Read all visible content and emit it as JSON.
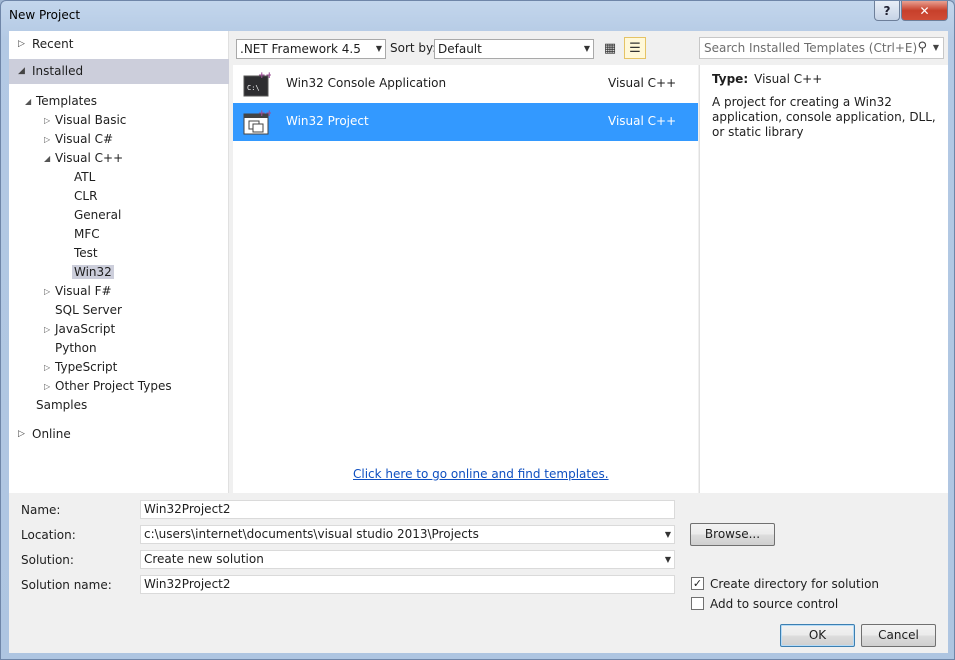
{
  "window": {
    "title": "New Project",
    "help_label": "?",
    "close_label": "✕"
  },
  "left": {
    "recent": "Recent",
    "installed": "Installed",
    "templates": "Templates",
    "tree": [
      {
        "label": "Visual Basic",
        "level": 2,
        "arrow": "▷"
      },
      {
        "label": "Visual C#",
        "level": 2,
        "arrow": "▷"
      },
      {
        "label": "Visual C++",
        "level": 2,
        "arrow": "◢"
      },
      {
        "label": "ATL",
        "level": 3,
        "arrow": ""
      },
      {
        "label": "CLR",
        "level": 3,
        "arrow": ""
      },
      {
        "label": "General",
        "level": 3,
        "arrow": ""
      },
      {
        "label": "MFC",
        "level": 3,
        "arrow": ""
      },
      {
        "label": "Test",
        "level": 3,
        "arrow": ""
      },
      {
        "label": "Win32",
        "level": 3,
        "arrow": "",
        "selected": true
      },
      {
        "label": "Visual F#",
        "level": 2,
        "arrow": "▷"
      },
      {
        "label": "SQL Server",
        "level": 2,
        "arrow": ""
      },
      {
        "label": "JavaScript",
        "level": 2,
        "arrow": "▷"
      },
      {
        "label": "Python",
        "level": 2,
        "arrow": ""
      },
      {
        "label": "TypeScript",
        "level": 2,
        "arrow": "▷"
      },
      {
        "label": "Other Project Types",
        "level": 2,
        "arrow": "▷"
      }
    ],
    "samples": "Samples",
    "online": "Online"
  },
  "toolbar": {
    "framework": ".NET Framework 4.5",
    "sort_label": "Sort by:",
    "sort_value": "Default",
    "search_placeholder": "Search Installed Templates (Ctrl+E)"
  },
  "templates": [
    {
      "name": "Win32 Console Application",
      "language": "Visual C++",
      "icon": "console-app-icon",
      "selected": false
    },
    {
      "name": "Win32 Project",
      "language": "Visual C++",
      "icon": "win32-project-icon",
      "selected": true
    }
  ],
  "online_link": "Click here to go online and find templates.",
  "info": {
    "type_label": "Type:",
    "type_value": "Visual C++",
    "description": "A project for creating a Win32 application, console application, DLL, or static library"
  },
  "form": {
    "name_label": "Name:",
    "name_value": "Win32Project2",
    "location_label": "Location:",
    "location_value": "c:\\users\\internet\\documents\\visual studio 2013\\Projects",
    "solution_label": "Solution:",
    "solution_value": "Create new solution",
    "solution_name_label": "Solution name:",
    "solution_name_value": "Win32Project2",
    "browse_label": "Browse...",
    "create_dir_label": "Create directory for solution",
    "create_dir_checked": true,
    "source_control_label": "Add to source control",
    "source_control_checked": false,
    "ok_label": "OK",
    "cancel_label": "Cancel"
  },
  "colors": {
    "selection": "#3399ff",
    "tree_selection": "#cccedb",
    "link": "#0e4fc0"
  }
}
